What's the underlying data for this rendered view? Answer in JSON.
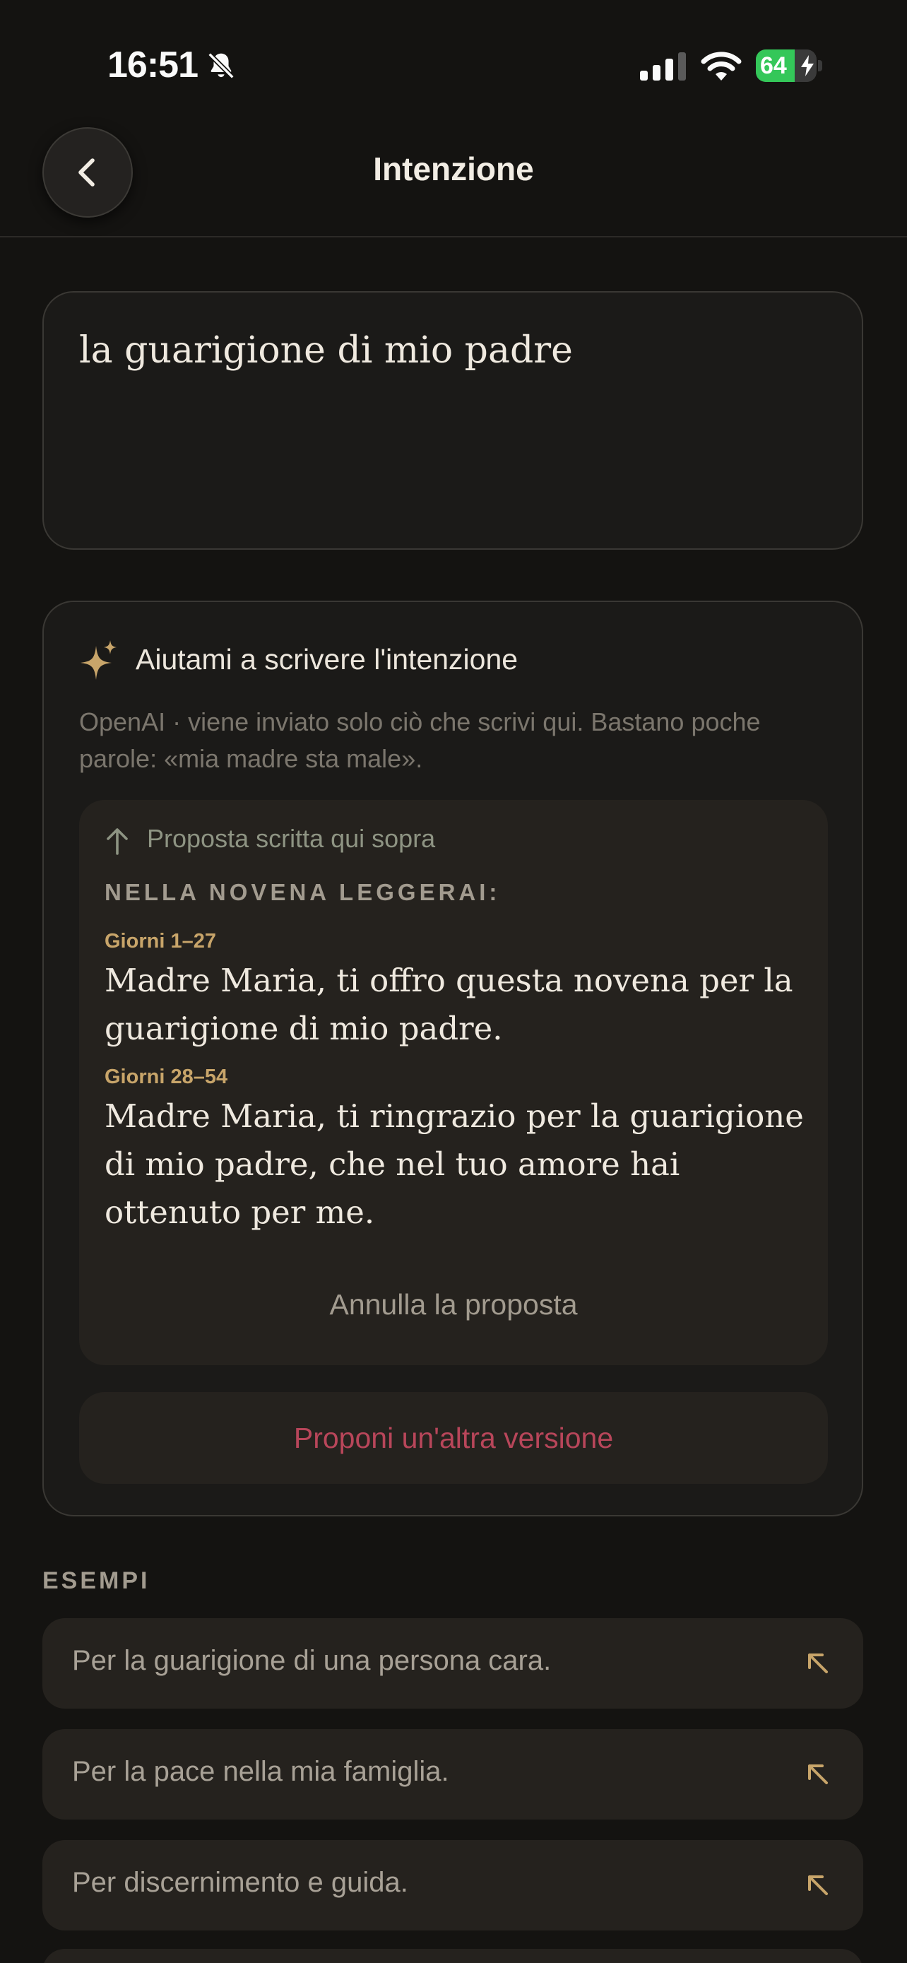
{
  "status_bar": {
    "time": "16:51",
    "battery_percent": 64,
    "battery_label": "64",
    "charging": true
  },
  "header": {
    "title": "Intenzione",
    "back_icon": "chevron-left-icon"
  },
  "intention_field": {
    "value": "la guarigione di mio padre"
  },
  "helper": {
    "icon": "sparkle-icon",
    "title": "Aiutami a scrivere l'intenzione",
    "description": "OpenAI · viene inviato solo ciò che scrivi qui. Bastano poche parole: «mia madre sta male».",
    "proposal": {
      "source_label": "Proposta scritta qui sopra",
      "reading_header": "NELLA NOVENA LEGGERAI:",
      "days": [
        {
          "range": "Giorni 1–27",
          "text": "Madre Maria, ti offro questa novena per la guarigione di mio padre."
        },
        {
          "range": "Giorni 28–54",
          "text": "Madre Maria, ti ringrazio per la guarigione di mio padre, che nel tuo amore hai ottenuto per me."
        }
      ],
      "cancel_label": "Annulla la proposta"
    },
    "regenerate_label": "Proponi un'altra versione"
  },
  "examples": {
    "title": "ESEMPI",
    "items": [
      {
        "label": "Per la guarigione di una persona cara."
      },
      {
        "label": "Per la pace nella mia famiglia."
      },
      {
        "label": "Per discernimento e guida."
      },
      {
        "label": ""
      }
    ]
  },
  "colors": {
    "background": "#141311",
    "card": "#1b1a18",
    "inner": "#25221e",
    "accent_gold": "#c8a56a",
    "accent_red": "#b8465a",
    "battery_green": "#34c759"
  }
}
